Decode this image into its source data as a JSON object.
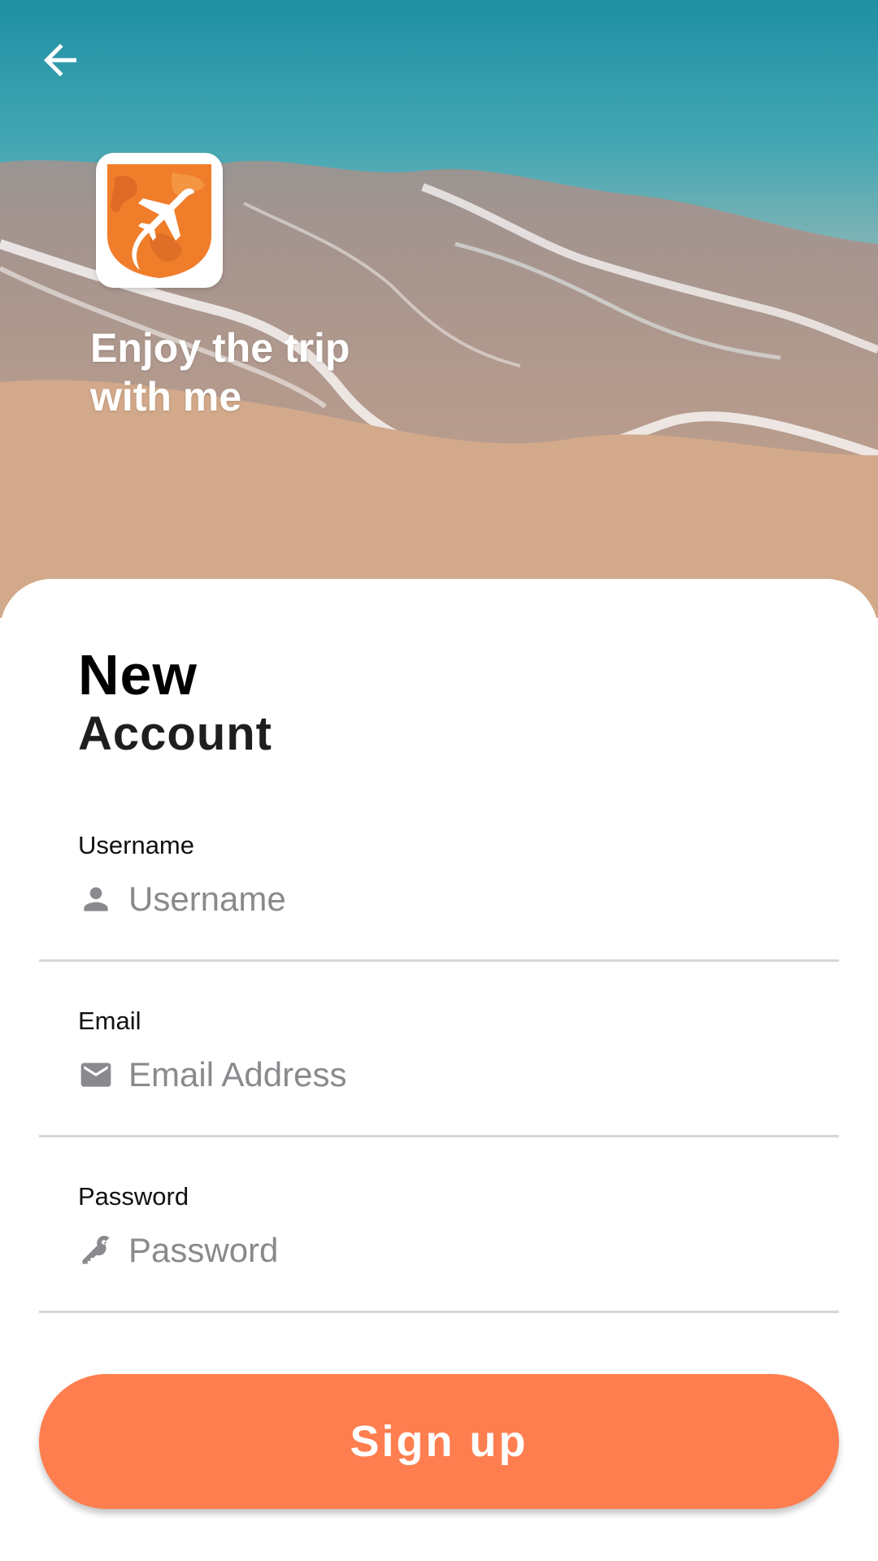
{
  "hero": {
    "tagline_line1": "Enjoy the trip",
    "tagline_line2": "with me",
    "back_icon": "arrow-back-icon",
    "logo_icon": "airplane-globe-logo",
    "logo_color": "#f07d2a"
  },
  "form": {
    "title_line1": "New",
    "title_line2": "Account",
    "fields": [
      {
        "label": "Username",
        "placeholder": "Username",
        "icon": "person-icon"
      },
      {
        "label": "Email",
        "placeholder": "Email Address",
        "icon": "mail-icon"
      },
      {
        "label": "Password",
        "placeholder": "Password",
        "icon": "key-icon"
      }
    ],
    "submit_label": "Sign up",
    "accent_color": "#ff7e50"
  }
}
